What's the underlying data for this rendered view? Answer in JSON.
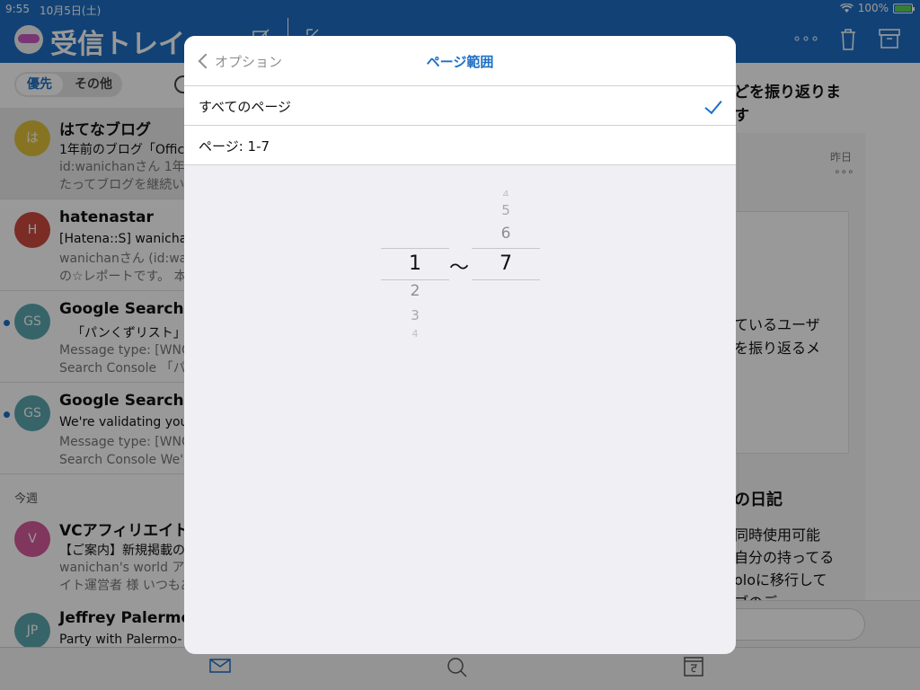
{
  "status_bar": {
    "time": "9:55",
    "date": "10月5日(土)",
    "battery": "100%",
    "battery_level": 1.0
  },
  "left_header": {
    "title": "受信トレイ"
  },
  "segment": {
    "focused": "優先",
    "other": "その他"
  },
  "messages": [
    {
      "avatar": "は",
      "avatar_color": "#e2c13b",
      "sender": "はてなブログ",
      "subject": "1年前のブログ「Offic",
      "preview1": "id:wanichanさん 1年",
      "preview2": "たってブログを継続い",
      "unread": false
    },
    {
      "avatar": "H",
      "avatar_color": "#cc4a3f",
      "sender": "hatenastar",
      "subject": "[Hatena::S] wanichar",
      "preview1": "wanichanさん (id:wan",
      "preview2": "の☆レポートです。 本",
      "unread": false
    },
    {
      "avatar": "GS",
      "avatar_color": "#5aa7b0",
      "sender": "Google Search Co",
      "subject": "「パンくずリスト」",
      "preview1": "Message type: [WNC",
      "preview2": "Search Console 「パ",
      "unread": true
    },
    {
      "avatar": "GS",
      "avatar_color": "#5aa7b0",
      "sender": "Google Search Co",
      "subject": "We're validating your",
      "preview1": "Message type: [WNC",
      "preview2": "Search Console We'r",
      "unread": true
    }
  ],
  "section_this_week": "今週",
  "messages_week": [
    {
      "avatar": "V",
      "avatar_color": "#d55a9c",
      "sender": "VCアフィリエイトサ",
      "subject": "【ご案内】新規掲載の",
      "preview1": "wanichan's world ア",
      "preview2": "イト運営者 様 いつもあ"
    },
    {
      "avatar": "JP",
      "avatar_color": "#5aa7b0",
      "sender": "Jeffrey Palermo",
      "subject": "Party with Palermo-",
      "preview1": "",
      "preview2": ""
    }
  ],
  "reading_pane": {
    "heading_tail": "どを振り返りま",
    "heading_tail2": "す",
    "date": "昨日",
    "more": "∘∘∘",
    "body1": "ているユーザ",
    "body2": "を振り返るメ",
    "section_title": "の日記",
    "body3": "同時使用可能",
    "body4": "自分の持ってる",
    "body5": "oloに移行して",
    "body6": "ブのデ"
  },
  "sheet": {
    "back_label": "オプション",
    "title": "ページ範囲",
    "option_all": "すべてのページ",
    "option_range": "ページ: 1-7",
    "picker_from": {
      "above": [],
      "selected": "1",
      "below": [
        "2",
        "3",
        "4"
      ]
    },
    "picker_to": {
      "above": [
        "4",
        "5",
        "6"
      ],
      "selected": "7",
      "below": []
    },
    "separator": "〜"
  },
  "colors": {
    "accent": "#1e6fc4",
    "unread": "#1e6fc4"
  }
}
